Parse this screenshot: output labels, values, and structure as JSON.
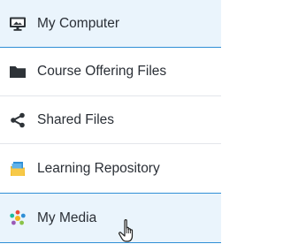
{
  "sidebar": {
    "items": [
      {
        "label": "My Computer",
        "icon": "monitor-icon",
        "active": true
      },
      {
        "label": "Course Offering Files",
        "icon": "folder-icon",
        "active": false
      },
      {
        "label": "Shared Files",
        "icon": "share-icon",
        "active": false
      },
      {
        "label": "Learning Repository",
        "icon": "repository-icon",
        "active": false
      },
      {
        "label": "My Media",
        "icon": "media-icon",
        "active": true
      }
    ]
  },
  "colors": {
    "active_background": "#eaf4fc",
    "active_border": "#2f8fd6",
    "text": "#2a2f36",
    "divider": "#e3e6ea"
  }
}
